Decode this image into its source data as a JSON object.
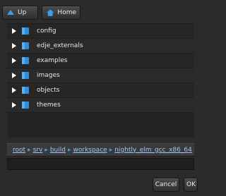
{
  "toolbar": {
    "up_label": "Up",
    "home_label": "Home"
  },
  "files": {
    "items": [
      {
        "name": "config",
        "icon": "folder-icon"
      },
      {
        "name": "edje_externals",
        "icon": "folder-icon"
      },
      {
        "name": "examples",
        "icon": "folder-icon"
      },
      {
        "name": "images",
        "icon": "folder-icon"
      },
      {
        "name": "objects",
        "icon": "folder-icon"
      },
      {
        "name": "themes",
        "icon": "folder-icon"
      }
    ]
  },
  "path": {
    "crumbs": [
      "root",
      "srv",
      "build",
      "workspace",
      "nightly_elm_gcc_x86_64"
    ]
  },
  "filename": {
    "value": ""
  },
  "actions": {
    "cancel_label": "Cancel",
    "ok_label": "OK"
  },
  "colors": {
    "accent": "#3e9de6",
    "background": "#2b2b2b"
  }
}
